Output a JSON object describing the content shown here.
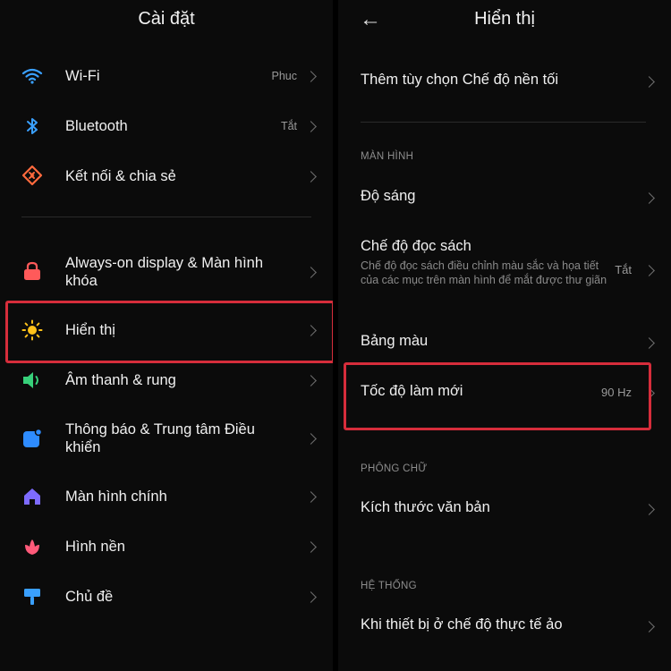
{
  "left": {
    "title": "Cài đặt",
    "items": [
      {
        "label": "Wi-Fi",
        "value": "Phuc",
        "icon": "wifi-icon"
      },
      {
        "label": "Bluetooth",
        "value": "Tắt",
        "icon": "bluetooth-icon"
      },
      {
        "label": "Kết nối & chia sẻ",
        "value": "",
        "icon": "connection-share-icon"
      },
      {
        "label": "Always-on display & Màn hình khóa",
        "value": "",
        "icon": "lock-icon"
      },
      {
        "label": "Hiển thị",
        "value": "",
        "icon": "sun-icon"
      },
      {
        "label": "Âm thanh & rung",
        "value": "",
        "icon": "speaker-icon"
      },
      {
        "label": "Thông báo & Trung tâm Điều khiển",
        "value": "",
        "icon": "notification-icon"
      },
      {
        "label": "Màn hình chính",
        "value": "",
        "icon": "home-icon"
      },
      {
        "label": "Hình nền",
        "value": "",
        "icon": "wallpaper-flower-icon"
      },
      {
        "label": "Chủ đề",
        "value": "",
        "icon": "theme-brush-icon"
      }
    ]
  },
  "right": {
    "title": "Hiển thị",
    "items": {
      "dark_mode": {
        "label": "Thêm tùy chọn Chế độ nền tối"
      },
      "section_screen": "MÀN HÌNH",
      "brightness": {
        "label": "Độ sáng"
      },
      "reading": {
        "label": "Chế độ đọc sách",
        "sub": "Chế độ đọc sách điều chỉnh màu sắc và họa tiết của các mục trên màn hình để mắt được thư giãn",
        "value": "Tắt"
      },
      "palette": {
        "label": "Bảng màu"
      },
      "refresh": {
        "label": "Tốc độ làm mới",
        "value": "90 Hz"
      },
      "section_font": "PHÔNG CHỮ",
      "text_size": {
        "label": "Kích thước văn bản"
      },
      "section_system": "HỆ THỐNG",
      "vr": {
        "label": "Khi thiết bị ở chế độ thực tế ảo"
      }
    }
  },
  "colors": {
    "highlight": "#d62d3b",
    "wifi": "#3aa0ff",
    "bluetooth": "#3aa0ff",
    "connection": "#ff6a3d",
    "lock": "#ff5a5a",
    "sun": "#ffc21a",
    "speaker": "#37d07a",
    "notification": "#2e8cff",
    "home": "#7d6bff",
    "wallpaper": "#ff5a7a",
    "theme": "#3aa0ff"
  }
}
